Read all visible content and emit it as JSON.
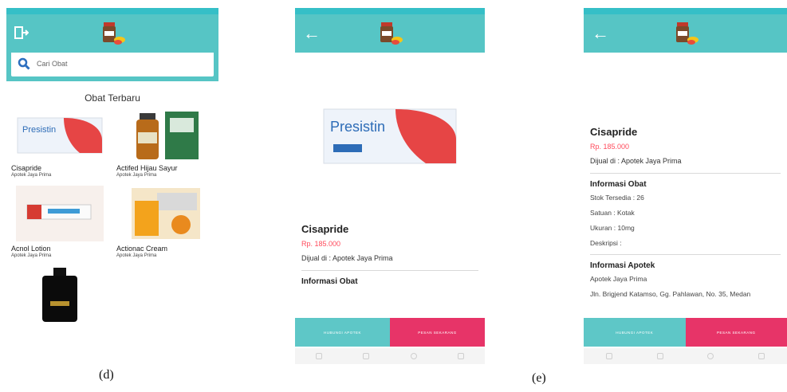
{
  "screens": {
    "list": {
      "search_placeholder": "Cari Obat",
      "section_title": "Obat Terbaru",
      "items": [
        {
          "name": "Cisapride",
          "seller": "Apotek Jaya Prima"
        },
        {
          "name": "Actifed Hijau Sayur",
          "seller": "Apotek Jaya Prima"
        },
        {
          "name": "Acnol Lotion",
          "seller": "Apotek Jaya Prima"
        },
        {
          "name": "Actionac Cream",
          "seller": "Apotek Jaya Prima"
        },
        {
          "name": "",
          "seller": ""
        }
      ]
    },
    "detail_top": {
      "title": "Cisapride",
      "price": "Rp. 185.000",
      "seller": "Dijual di : Apotek Jaya Prima",
      "info_heading": "Informasi Obat",
      "contact_btn": "HUBUNGI APOTEK",
      "order_btn": "PESAN SEKARANG"
    },
    "detail_scrolled": {
      "title": "Cisapride",
      "price": "Rp. 185.000",
      "seller": "Dijual di : Apotek Jaya Prima",
      "info_heading": "Informasi Obat",
      "stock": "Stok Tersedia : 26",
      "unit": "Satuan : Kotak",
      "size": "Ukuran : 10mg",
      "description": "Deskripsi :",
      "pharmacy_heading": "Informasi Apotek",
      "pharmacy_name": "Apotek Jaya Prima",
      "pharmacy_address": "Jln. Brigjend Katamso, Gg. Pahlawan, No. 35, Medan",
      "contact_btn": "HUBUNGI APOTEK",
      "order_btn": "PESAN SEKARANG"
    }
  },
  "captions": {
    "left": "(d)",
    "right": "(e)"
  },
  "colors": {
    "teal": "#56c5c5",
    "price": "#ff4b5c",
    "order": "#e73468"
  }
}
